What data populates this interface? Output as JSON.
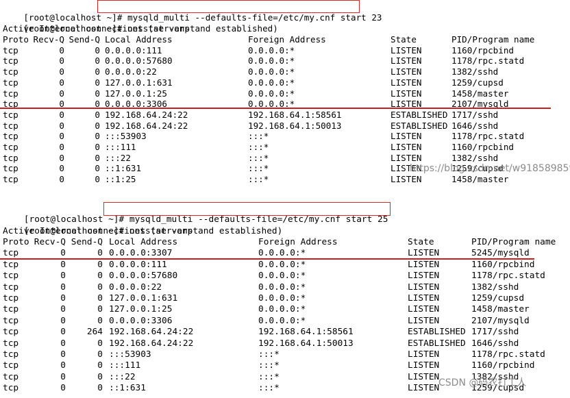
{
  "terminal_1": {
    "prompt_1": "[root@localhost ~]#",
    "command_1": " mysqld_multi --defaults-file=/etc/my.cnf start 23",
    "prompt_2": "[root@localhost ~]#",
    "command_2": " netstat -anpt",
    "banner": "Active Internet connections (servers and established)",
    "headers": [
      "Proto",
      "Recv-Q",
      "Send-Q",
      "Local Address",
      "Foreign Address",
      "State",
      "PID/Program name"
    ],
    "rows": [
      [
        "tcp",
        "0",
        "0",
        "0.0.0.0:111",
        "0.0.0.0:*",
        "LISTEN",
        "1160/rpcbind"
      ],
      [
        "tcp",
        "0",
        "0",
        "0.0.0.0:57680",
        "0.0.0.0:*",
        "LISTEN",
        "1178/rpc.statd"
      ],
      [
        "tcp",
        "0",
        "0",
        "0.0.0.0:22",
        "0.0.0.0:*",
        "LISTEN",
        "1382/sshd"
      ],
      [
        "tcp",
        "0",
        "0",
        "127.0.0.1:631",
        "0.0.0.0:*",
        "LISTEN",
        "1259/cupsd"
      ],
      [
        "tcp",
        "0",
        "0",
        "127.0.0.1:25",
        "0.0.0.0:*",
        "LISTEN",
        "1458/master"
      ],
      [
        "tcp",
        "0",
        "0",
        "0.0.0.0:3306",
        "0.0.0.0:*",
        "LISTEN",
        "2107/mysqld"
      ],
      [
        "tcp",
        "0",
        "0",
        "192.168.64.24:22",
        "192.168.64.1:58561",
        "ESTABLISHED",
        "1717/sshd"
      ],
      [
        "tcp",
        "0",
        "0",
        "192.168.64.24:22",
        "192.168.64.1:50013",
        "ESTABLISHED",
        "1646/sshd"
      ],
      [
        "tcp",
        "0",
        "0",
        ":::53903",
        ":::*",
        "LISTEN",
        "1178/rpc.statd"
      ],
      [
        "tcp",
        "0",
        "0",
        ":::111",
        ":::*",
        "LISTEN",
        "1160/rpcbind"
      ],
      [
        "tcp",
        "0",
        "0",
        ":::22",
        ":::*",
        "LISTEN",
        "1382/sshd"
      ],
      [
        "tcp",
        "0",
        "0",
        "::1:631",
        ":::*",
        "LISTEN",
        "1259/cupsd"
      ],
      [
        "tcp",
        "0",
        "0",
        "::1:25",
        ":::*",
        "LISTEN",
        "1458/master"
      ]
    ],
    "highlighted_row": 5,
    "watermark": "https://blog.csdn.net/w918589859"
  },
  "terminal_2": {
    "prompt_1": "[root@localhost ~]#",
    "command_1": " mysqld_multi --defaults-file=/etc/my.cnf start 25",
    "prompt_2": "[root@localhost ~]#",
    "command_2": " netstat -anpt",
    "banner": "Active Internet connections (servers and established)",
    "headers": [
      "Proto",
      "Recv-Q",
      "Send-Q",
      "Local Address",
      "Foreign Address",
      "State",
      "PID/Program name"
    ],
    "rows": [
      [
        "tcp",
        "0",
        "0",
        "0.0.0.0:3307",
        "0.0.0.0:*",
        "LISTEN",
        "5245/mysqld"
      ],
      [
        "tcp",
        "0",
        "0",
        "0.0.0.0:111",
        "0.0.0.0:*",
        "LISTEN",
        "1160/rpcbind"
      ],
      [
        "tcp",
        "0",
        "0",
        "0.0.0.0:57680",
        "0.0.0.0:*",
        "LISTEN",
        "1178/rpc.statd"
      ],
      [
        "tcp",
        "0",
        "0",
        "0.0.0.0:22",
        "0.0.0.0:*",
        "LISTEN",
        "1382/sshd"
      ],
      [
        "tcp",
        "0",
        "0",
        "127.0.0.1:631",
        "0.0.0.0:*",
        "LISTEN",
        "1259/cupsd"
      ],
      [
        "tcp",
        "0",
        "0",
        "127.0.0.1:25",
        "0.0.0.0:*",
        "LISTEN",
        "1458/master"
      ],
      [
        "tcp",
        "0",
        "0",
        "0.0.0.0:3306",
        "0.0.0.0:*",
        "LISTEN",
        "2107/mysqld"
      ],
      [
        "tcp",
        "0",
        "264",
        "192.168.64.24:22",
        "192.168.64.1:58561",
        "ESTABLISHED",
        "1717/sshd"
      ],
      [
        "tcp",
        "0",
        "0",
        "192.168.64.24:22",
        "192.168.64.1:50013",
        "ESTABLISHED",
        "1646/sshd"
      ],
      [
        "tcp",
        "0",
        "0",
        ":::53903",
        ":::*",
        "LISTEN",
        "1178/rpc.statd"
      ],
      [
        "tcp",
        "0",
        "0",
        ":::111",
        ":::*",
        "LISTEN",
        "1160/rpcbind"
      ],
      [
        "tcp",
        "0",
        "0",
        ":::22",
        ":::*",
        "LISTEN",
        "1382/sshd"
      ],
      [
        "tcp",
        "0",
        "0",
        "::1:631",
        ":::*",
        "LISTEN",
        "1259/cupsd"
      ]
    ],
    "highlighted_row": 0,
    "watermark": "CSDN @码农打工人"
  },
  "colors": {
    "annotation_red": "#c81e1e",
    "text": "#000000",
    "background": "#ffffff",
    "watermark": "#8c8c8c"
  }
}
